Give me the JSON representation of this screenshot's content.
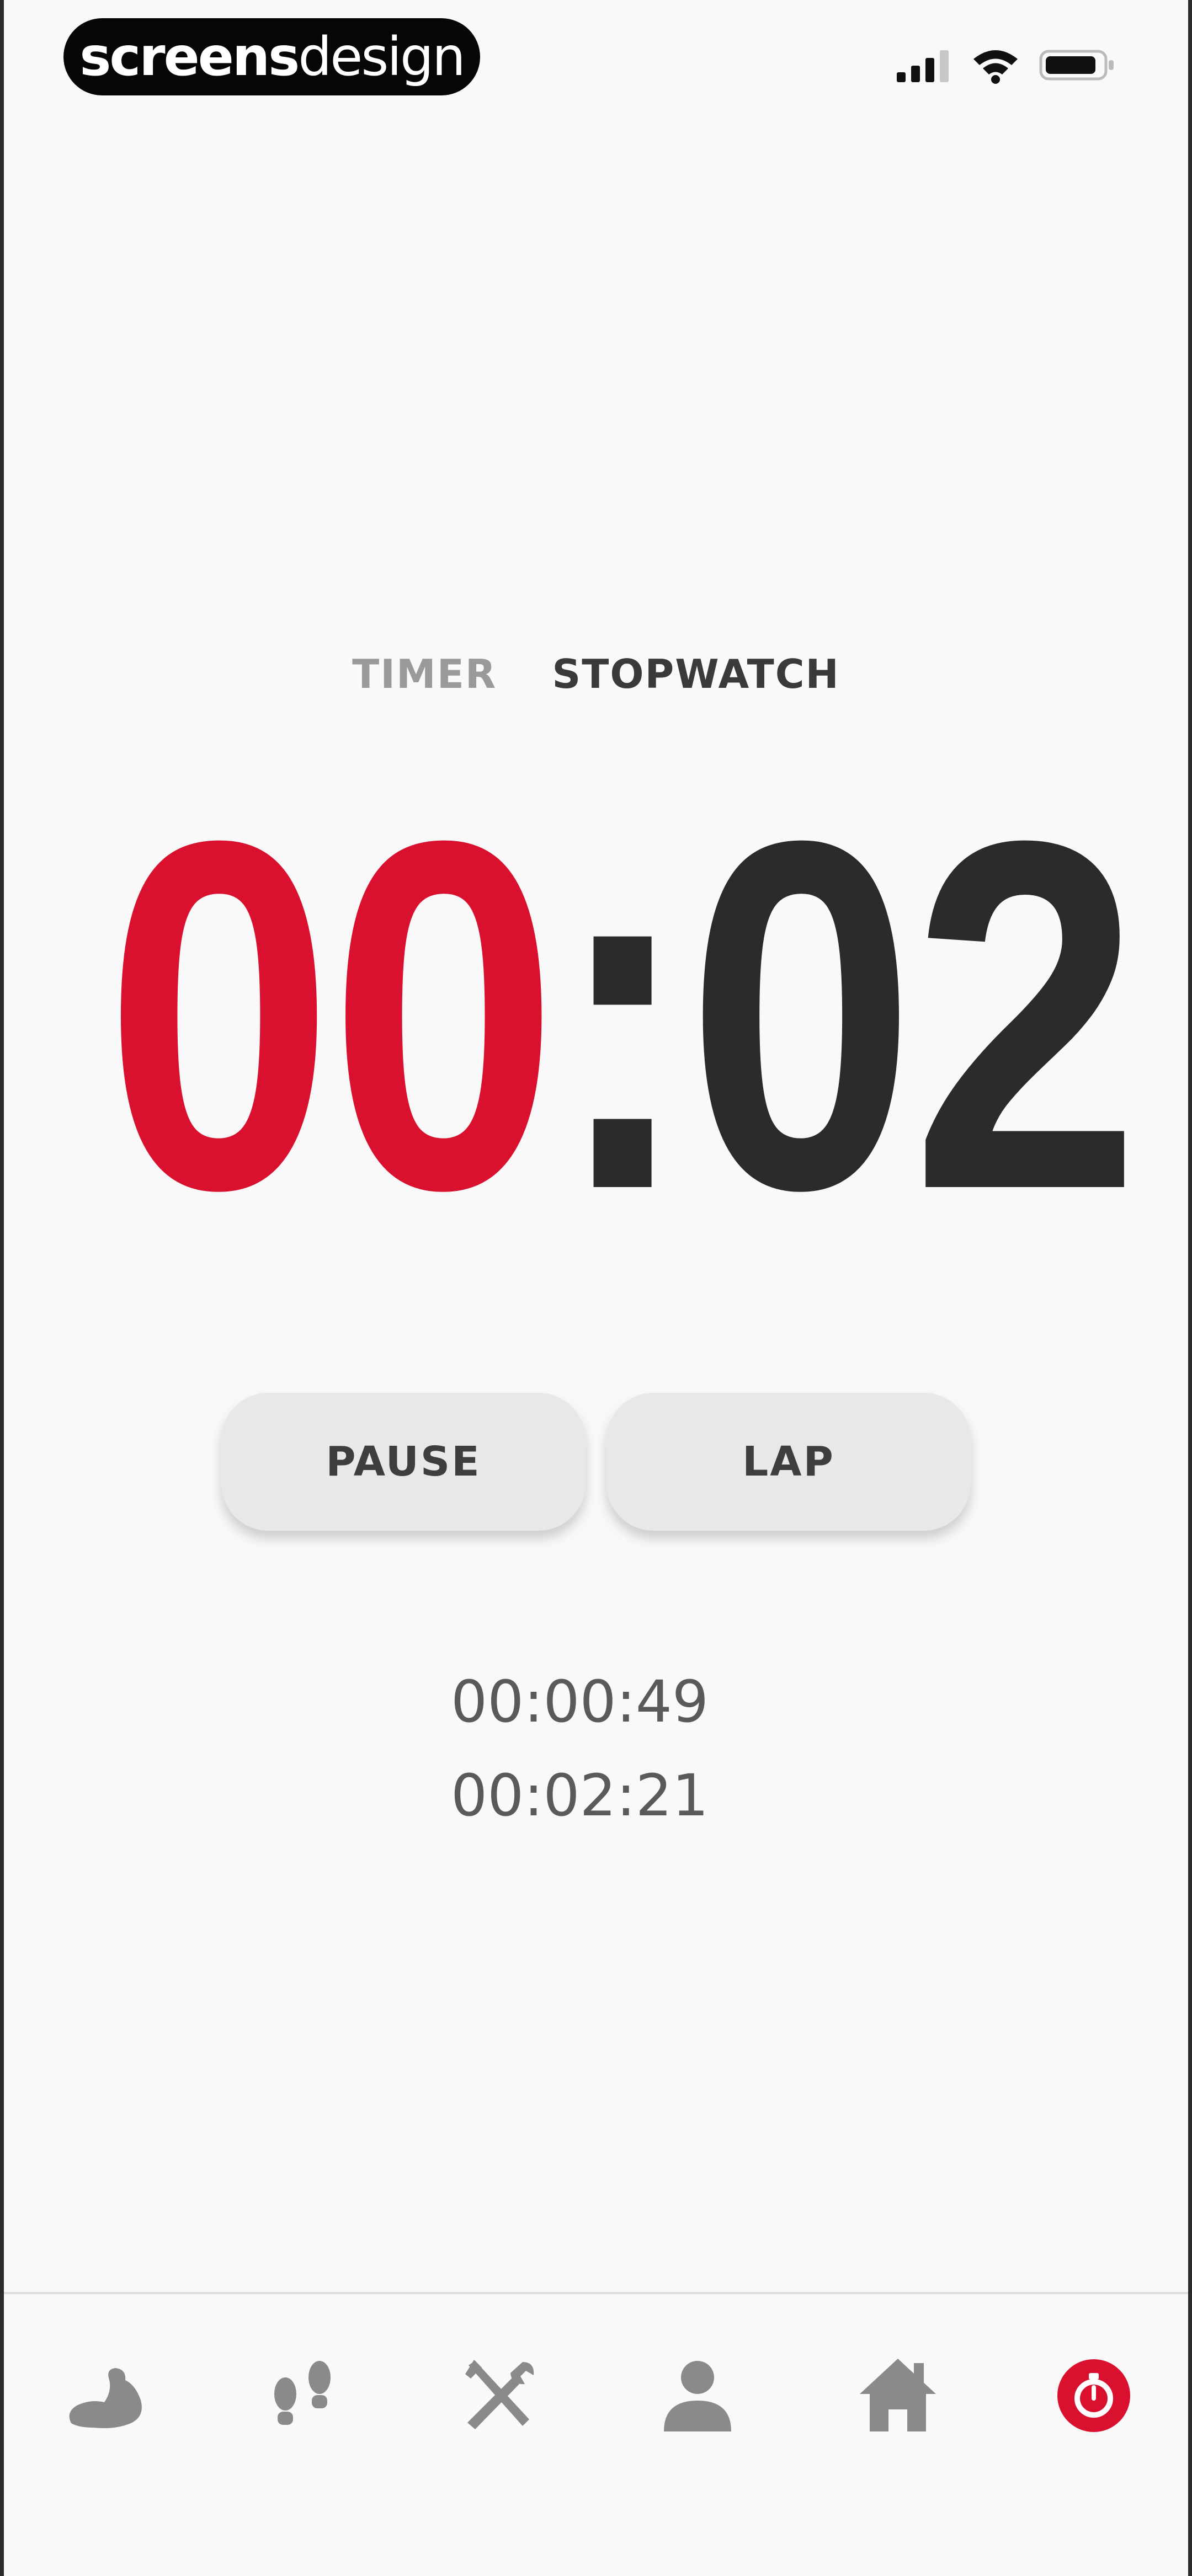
{
  "status_bar": {
    "brand_bold": "screens",
    "brand_light": "design"
  },
  "tabs": {
    "timer": "TIMER",
    "stopwatch": "STOPWATCH",
    "active": "stopwatch"
  },
  "stopwatch": {
    "minutes": "00",
    "separator": ":",
    "seconds": "02"
  },
  "controls": {
    "pause_label": "PAUSE",
    "lap_label": "LAP"
  },
  "laps": [
    "00:00:49",
    "00:02:21"
  ],
  "bottom_nav": {
    "items": [
      "muscle-icon",
      "footprints-icon",
      "tools-icon",
      "profile-icon",
      "home-icon",
      "stopwatch-icon"
    ],
    "active": "stopwatch-icon"
  },
  "colors": {
    "accent": "#d9102e",
    "text_dark": "#2b2b2b",
    "icon_gray": "#8a8a8a",
    "button_bg": "#e8e8e8"
  }
}
